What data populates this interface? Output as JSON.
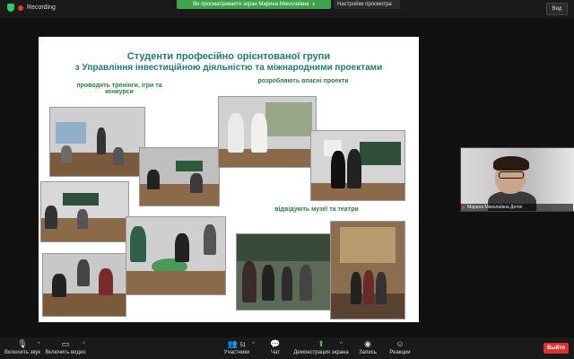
{
  "topbar": {
    "recording_label": "Recording",
    "viewing_banner": "Ви просматриваете экран Марина Миколаївна",
    "view_options": "Настройки просмотра",
    "view_button": "Вид"
  },
  "slide": {
    "title_line1": "Студенти професійно орієнтованої групи",
    "title_line2": "з Управління інвестиційною діяльністю та міжнародними проектами",
    "label_trainings": "проводять тренінги, ігри та конкурси",
    "label_projects": "розробляють власні проекти",
    "label_museums": "відвідують музеї та театри"
  },
  "participant": {
    "name": "Марина Миколаївна Детіні"
  },
  "toolbar": {
    "audio_label": "Включить звук",
    "video_label": "Включить видео",
    "participants_label": "Участники",
    "participants_count": "51",
    "chat_label": "Чат",
    "share_label": "Демонстрация экрана",
    "record_label": "Запись",
    "reactions_label": "Реакции",
    "leave_label": "Выйти"
  },
  "colors": {
    "title_teal": "#1e7b6e",
    "label_green": "#2a7a44",
    "leave_red": "#d9352b",
    "share_green": "#3fbf5a"
  }
}
